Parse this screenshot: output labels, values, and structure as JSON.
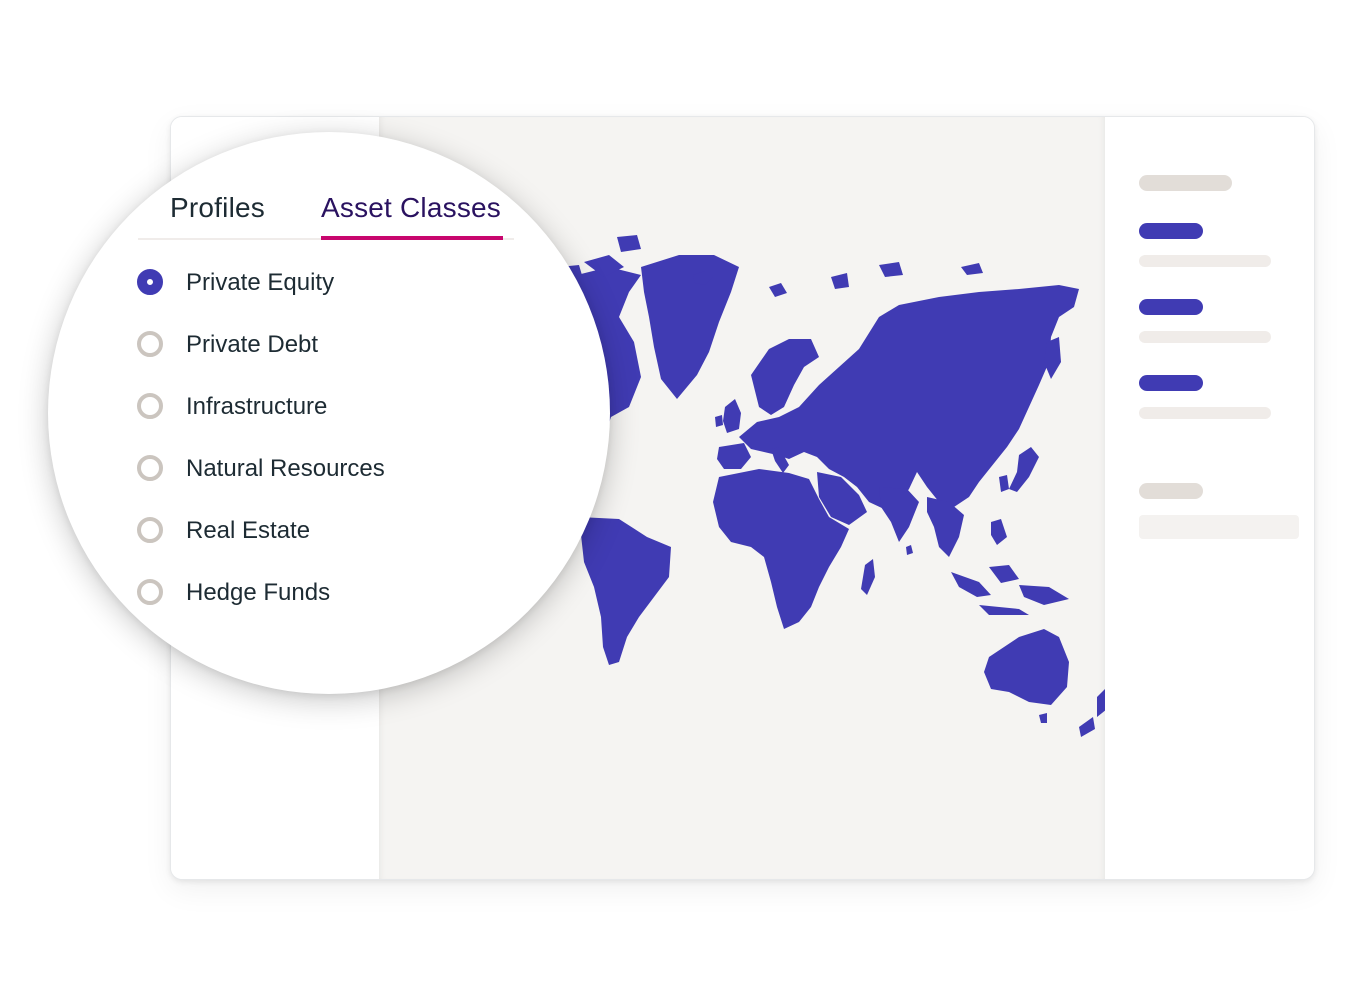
{
  "colors": {
    "brand": "#403bb3",
    "accent_underline": "#c8066e",
    "active_tab_text": "#2a1260",
    "text": "#1d2b33",
    "radio_unchecked": "#cbc5bf",
    "map_background": "#f5f4f2",
    "land": "#403bb3"
  },
  "tabs": [
    {
      "label": "Profiles",
      "active": false
    },
    {
      "label": "Asset Classes",
      "active": true
    }
  ],
  "asset_classes": {
    "selected": "Private Equity",
    "options": [
      {
        "label": "Private Equity",
        "checked": true
      },
      {
        "label": "Private Debt",
        "checked": false
      },
      {
        "label": "Infrastructure",
        "checked": false
      },
      {
        "label": "Natural Resources",
        "checked": false
      },
      {
        "label": "Real Estate",
        "checked": false
      },
      {
        "label": "Hedge Funds",
        "checked": false
      }
    ]
  },
  "map": {
    "type": "world-map",
    "highlighted_regions": [
      "North America",
      "Greenland",
      "South America",
      "Europe",
      "Africa",
      "Asia",
      "Oceania"
    ]
  },
  "right_panel": {
    "placeholder_rows": [
      "heading-skeleton",
      "item-skeleton",
      "item-skeleton",
      "item-skeleton",
      "footer-skeleton"
    ]
  }
}
